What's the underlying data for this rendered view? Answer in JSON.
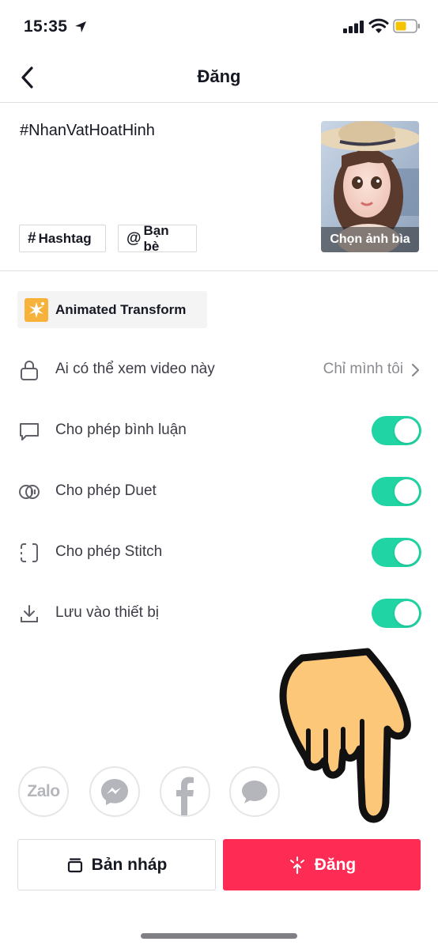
{
  "status_bar": {
    "time": "15:35"
  },
  "header": {
    "title": "Đăng"
  },
  "caption": {
    "text": "#NhanVatHoatHinh"
  },
  "chips": {
    "hashtag": "Hashtag",
    "friends": "Bạn bè"
  },
  "cover": {
    "label": "Chọn ảnh bìa"
  },
  "effect": {
    "label": "Animated Transform"
  },
  "privacy": {
    "label": "Ai có thể xem video này",
    "value": "Chỉ mình tôi"
  },
  "settings": [
    {
      "label": "Cho phép bình luận",
      "enabled": true
    },
    {
      "label": "Cho phép Duet",
      "enabled": true
    },
    {
      "label": "Cho phép Stitch",
      "enabled": true
    },
    {
      "label": "Lưu vào thiết bị",
      "enabled": true
    }
  ],
  "share": {
    "zalo_label": "Zalo"
  },
  "buttons": {
    "draft": "Bản nháp",
    "post": "Đăng"
  },
  "colors": {
    "toggle_on": "#20d5a3",
    "post_button": "#fe2c55",
    "effect_icon": "#f6b23a"
  },
  "icons": [
    "location-arrow-icon",
    "signal-icon",
    "wifi-icon",
    "battery-icon",
    "back-chevron-icon",
    "hashtag-icon",
    "at-icon",
    "sparkle-icon",
    "lock-icon",
    "comment-icon",
    "duet-icon",
    "stitch-icon",
    "download-icon",
    "chevron-right-icon",
    "zalo-icon",
    "messenger-icon",
    "facebook-icon",
    "message-icon",
    "draft-icon",
    "post-sparkle-icon"
  ]
}
